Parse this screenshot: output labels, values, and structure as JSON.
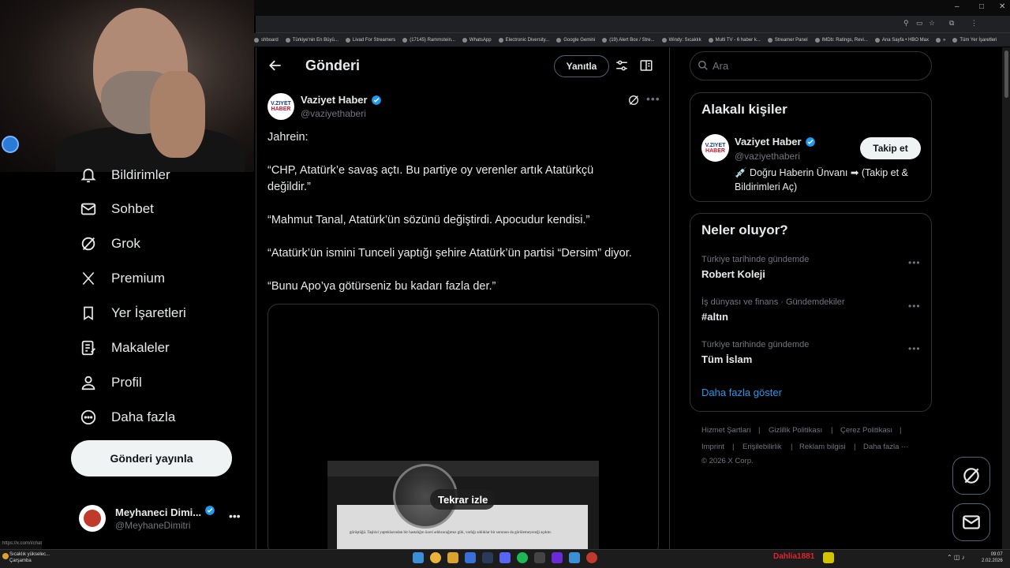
{
  "browser": {
    "bookmarks": [
      "shboard",
      "Türkiye'nin En Büyü...",
      "Livad For Streamers",
      "(17145) Rammstein...",
      "WhatsApp",
      "Electronic Diversity...",
      "Google Gemini",
      "(19) Alert Box / Stre...",
      "Windy: Sıcaklık",
      "Multi TV - 6 haber k...",
      "Streamer Panel",
      "IMDb: Ratings, Revi...",
      "Ana Sayfa • HBO Max",
      "»",
      "Tüm Yer İşaretleri"
    ],
    "status_url": "https://x.com/i/chat"
  },
  "nav": {
    "items": [
      {
        "label": "Bildirimler",
        "icon": "bell-icon"
      },
      {
        "label": "Sohbet",
        "icon": "mail-icon"
      },
      {
        "label": "Grok",
        "icon": "grok-icon"
      },
      {
        "label": "Premium",
        "icon": "x-logo-icon"
      },
      {
        "label": "Yer İşaretleri",
        "icon": "bookmark-icon"
      },
      {
        "label": "Makaleler",
        "icon": "article-icon"
      },
      {
        "label": "Profil",
        "icon": "person-icon"
      },
      {
        "label": "Daha fazla",
        "icon": "more-circle-icon"
      }
    ],
    "post_button": "Gönderi yayınla",
    "account": {
      "name": "Meyhaneci Dimi...",
      "handle": "@MeyhaneDimitri",
      "more": "•••"
    }
  },
  "main": {
    "title": "Gönderi",
    "reply_button": "Yanıtla",
    "tweet": {
      "avatar_line1": "V.ZIYET",
      "avatar_line2": "HABER",
      "name": "Vaziyet Haber",
      "handle": "@vaziyethaberi",
      "lines": [
        "Jahrein:",
        "“CHP, Atatürk’e savaş açtı. Bu partiye oy verenler artık Atatürkçü",
        "değildir.”",
        "“Mahmut Tanal, Atatürk’ün sözünü değiştirdi. Apocudur kendisi.”",
        "“Atatürk’ün ismini Tunceli yaptığı şehire Atatürk’ün partisi “Dersim” diyor.",
        "“Bunu Apo’ya götürseniz bu kadarı fazla der.”"
      ],
      "media": {
        "replay_label": "Tekrar izle",
        "paper_text": "görüştüğü. Taşbixi yaptıklarından bir hastalığın üzeri addıracağımız gibi, varlığı sıklıklar bir sorunun da görülemeyeceği açıktır."
      }
    }
  },
  "right": {
    "search_placeholder": "Ara",
    "related": {
      "title": "Alakalı kişiler",
      "name": "Vaziyet Haber",
      "handle": "@vaziyethaberi",
      "follow": "Takip et",
      "bio": "💉 Doğru Haberin Ünvanı ➡ (Takip et & Bildirimleri Aç)"
    },
    "trends": {
      "title": "Neler oluyor?",
      "items": [
        {
          "category": "Türkiye tarihinde gündemde",
          "name": "Robert Koleji"
        },
        {
          "category": "İş dünyası ve finans · Gündemdekiler",
          "name": "#altın"
        },
        {
          "category": "Türkiye tarihinde gündemde",
          "name": "Tüm İslam"
        }
      ],
      "show_more": "Daha fazla göster"
    },
    "footer": {
      "row1": [
        "Hizmet Şartları",
        "|",
        "Gizlilik Politikası",
        "|",
        "Çerez Politikası",
        "|"
      ],
      "row2": [
        "Imprint",
        "|",
        "Erişilebilirlik",
        "|",
        "Reklam bilgisi",
        "|",
        "Daha fazla ···"
      ],
      "copyright": "© 2026 X Corp."
    }
  },
  "taskbar": {
    "weather_line1": "Sıcaklık yükselec...",
    "weather_line2": "Çarşamba",
    "user": "Dahlia1881",
    "time": "09:07",
    "date": "2.02.2026"
  },
  "colors": {
    "accent": "#1d9bf0",
    "background": "#000000",
    "border": "#2f3336"
  }
}
